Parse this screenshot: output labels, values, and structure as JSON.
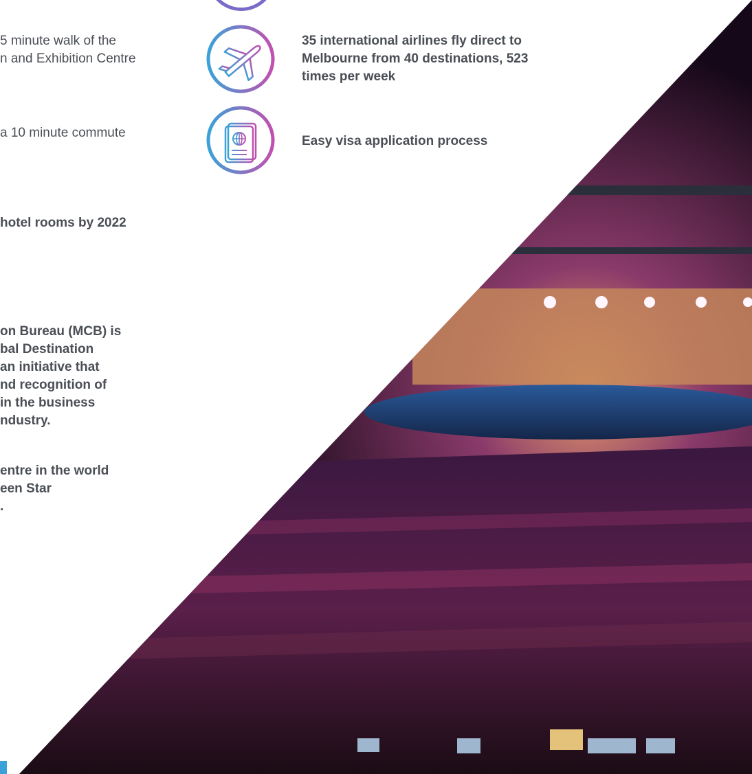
{
  "left_column": {
    "walk_text": "5 minute walk of the\nn and Exhibition Centre",
    "commute_text": "a 10 minute commute",
    "hotel_text": "hotel rooms by 2022",
    "mcb_paragraph": "on Bureau (MCB) is\nbal Destination\nan initiative that\nnd recognition of\nin the business\nndustry.",
    "green_paragraph": "entre in the world\neen Star\n."
  },
  "right_column": {
    "airlines_text": "35 international airlines fly direct to\nMelbourne from 40 destinations, 523\ntimes per week",
    "visa_text": "Easy visa application process"
  },
  "icons": {
    "top_partial": "circle-icon",
    "plane": "airplane-icon",
    "passport": "passport-icon"
  },
  "colors": {
    "text": "#4a4e55",
    "gradient_start": "#3aa2d8",
    "gradient_end": "#c24fb0"
  }
}
